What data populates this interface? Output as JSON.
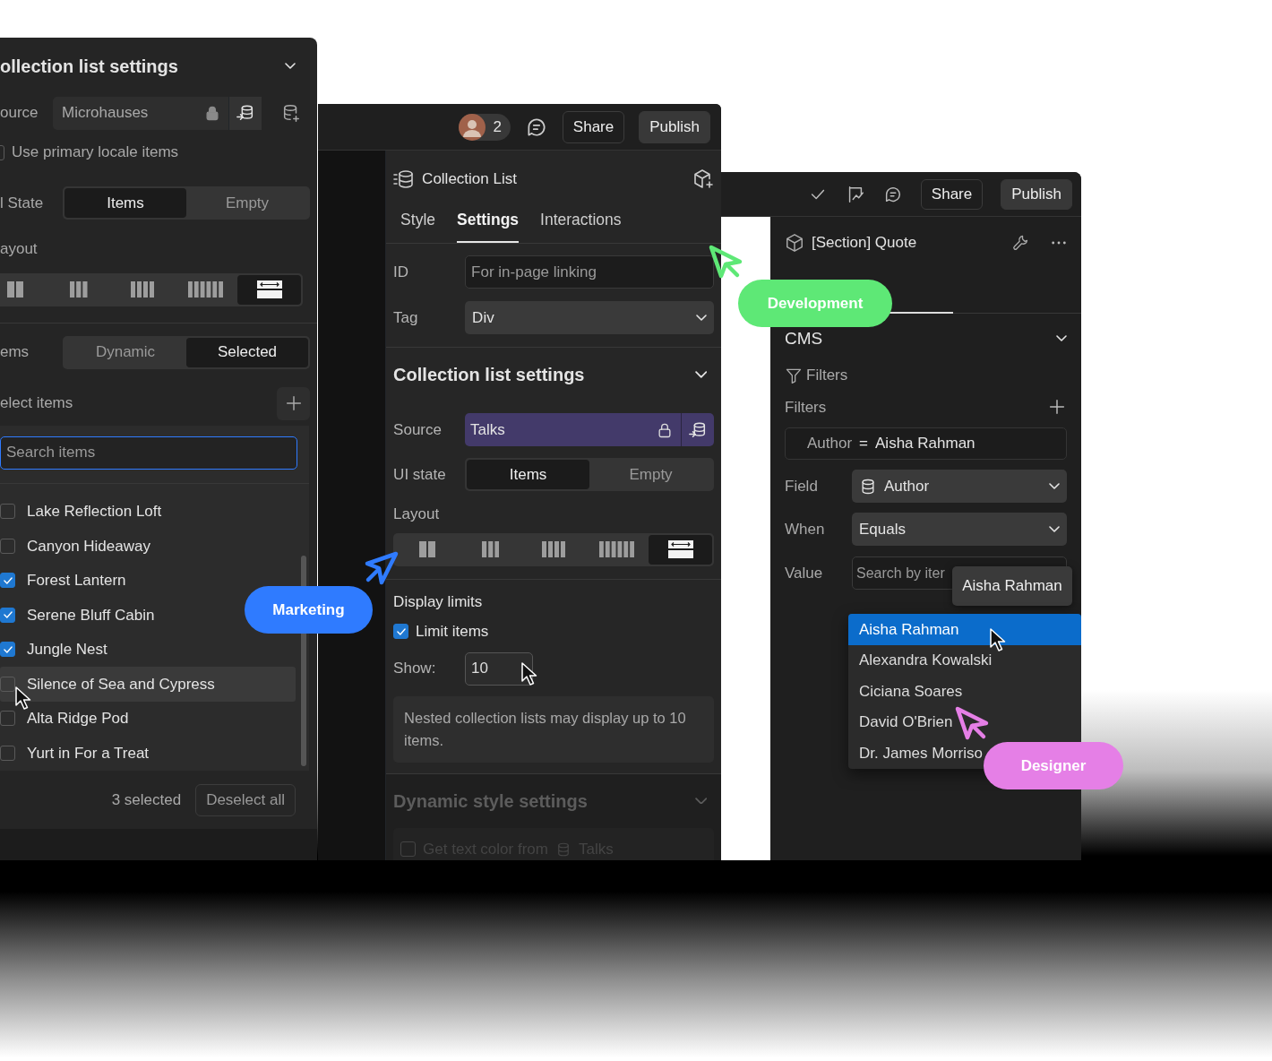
{
  "left_window": {
    "title": "ollection list settings",
    "source": {
      "label": "ource",
      "value": "Microhauses"
    },
    "locale": {
      "label": "Use primary locale items",
      "checked": false
    },
    "ui_state": {
      "label": "l State",
      "options": [
        {
          "label": "Items",
          "selected": true
        },
        {
          "label": "Empty",
          "selected": false
        }
      ]
    },
    "layout": {
      "label": "ayout",
      "options": [
        {
          "kind": "grid2",
          "selected": false
        },
        {
          "kind": "grid3",
          "selected": false
        },
        {
          "kind": "grid4",
          "selected": false
        },
        {
          "kind": "grid6",
          "selected": false
        },
        {
          "kind": "stack",
          "selected": true
        }
      ]
    },
    "items_mode": {
      "label": "ems",
      "options": [
        {
          "label": "Dynamic",
          "selected": false
        },
        {
          "label": "Selected",
          "selected": true
        }
      ]
    },
    "select_items": {
      "label": "elect items"
    },
    "search": {
      "placeholder": "Search items"
    },
    "items": [
      {
        "label": "Lake Reflection Loft",
        "checked": false,
        "hovered": false
      },
      {
        "label": "Canyon Hideaway",
        "checked": false,
        "hovered": false
      },
      {
        "label": "Forest Lantern",
        "checked": true,
        "hovered": false
      },
      {
        "label": "Serene Bluff Cabin",
        "checked": true,
        "hovered": false
      },
      {
        "label": "Jungle Nest",
        "checked": true,
        "hovered": false
      },
      {
        "label": "Silence of Sea and Cypress",
        "checked": false,
        "hovered": true
      },
      {
        "label": "Alta Ridge Pod",
        "checked": false,
        "hovered": false
      },
      {
        "label": "Yurt in For a Treat",
        "checked": false,
        "hovered": false
      }
    ],
    "footer": {
      "count": "3 selected",
      "button": "Deselect all"
    }
  },
  "middle_window": {
    "toolbar": {
      "collaborators": "2",
      "share": "Share",
      "publish": "Publish"
    },
    "title": "Collection List",
    "tabs": [
      {
        "label": "Style",
        "selected": false
      },
      {
        "label": "Settings",
        "selected": true
      },
      {
        "label": "Interactions",
        "selected": false
      }
    ],
    "id": {
      "label": "ID",
      "placeholder": "For in-page linking"
    },
    "tag": {
      "label": "Tag",
      "value": "Div"
    },
    "section_title": "Collection list settings",
    "source": {
      "label": "Source",
      "value": "Talks"
    },
    "ui_state": {
      "label": "UI state",
      "options": [
        {
          "label": "Items",
          "selected": true
        },
        {
          "label": "Empty",
          "selected": false
        }
      ]
    },
    "layout": {
      "label": "Layout",
      "options": [
        {
          "kind": "grid2",
          "selected": false
        },
        {
          "kind": "grid3",
          "selected": false
        },
        {
          "kind": "grid4",
          "selected": false
        },
        {
          "kind": "grid6",
          "selected": false
        },
        {
          "kind": "stack",
          "selected": true
        }
      ]
    },
    "display_limits": {
      "title": "Display limits",
      "limit": {
        "label": "Limit items",
        "checked": true
      },
      "show": {
        "label": "Show:",
        "value": "10"
      },
      "note": "Nested collection lists may display up to 10 items."
    },
    "dynamic_section": {
      "title": "Dynamic style settings",
      "option": {
        "label": "Get text color from",
        "source": "Talks",
        "checked": false
      }
    }
  },
  "right_window": {
    "toolbar": {
      "share": "Share",
      "publish": "Publish"
    },
    "title": "[Section] Quote",
    "section": "CMS",
    "filters_tab": "Filters",
    "filters_label": "Filters",
    "filter": {
      "field": "Author",
      "operator": "=",
      "value": "Aisha Rahman"
    },
    "field": {
      "label": "Field",
      "value": "Author"
    },
    "when": {
      "label": "When",
      "value": "Equals"
    },
    "value": {
      "label": "Value",
      "placeholder": "Search by iter"
    },
    "tooltip": "Aisha Rahman",
    "options": [
      {
        "label": "Aisha Rahman",
        "selected": true
      },
      {
        "label": "Alexandra Kowalski",
        "selected": false
      },
      {
        "label": "Ciciana Soares",
        "selected": false
      },
      {
        "label": "David O'Brien",
        "selected": false
      },
      {
        "label": "Dr. James Morriso",
        "selected": false
      }
    ]
  },
  "cursors": [
    {
      "label": "Marketing",
      "color": "#2f7bff"
    },
    {
      "label": "Development",
      "color": "#5ee876"
    },
    {
      "label": "Designer",
      "color": "#e57fe6"
    }
  ]
}
